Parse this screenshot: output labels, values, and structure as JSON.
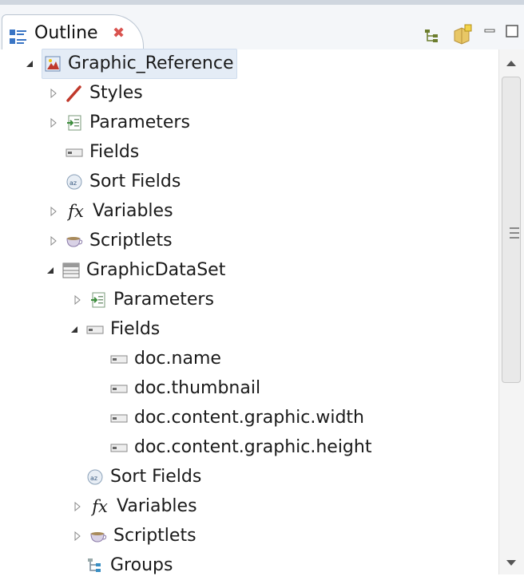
{
  "view": {
    "tab_title": "Outline",
    "close_glyph": "✖"
  },
  "tree": {
    "rows": [
      {
        "label": "Graphic_Reference"
      },
      {
        "label": "Styles"
      },
      {
        "label": "Parameters"
      },
      {
        "label": "Fields"
      },
      {
        "label": "Sort Fields"
      },
      {
        "label": "Variables"
      },
      {
        "label": "Scriptlets"
      },
      {
        "label": "GraphicDataSet"
      },
      {
        "label": "Parameters"
      },
      {
        "label": "Fields"
      },
      {
        "label": "doc.name"
      },
      {
        "label": "doc.thumbnail"
      },
      {
        "label": "doc.content.graphic.width"
      },
      {
        "label": "doc.content.graphic.height"
      },
      {
        "label": "Sort Fields"
      },
      {
        "label": "Variables"
      },
      {
        "label": "Scriptlets"
      },
      {
        "label": "Groups"
      }
    ]
  },
  "icons": {
    "fx_glyph": "fx"
  },
  "colors": {
    "selection": "#e4ecf6",
    "close": "#d9534f",
    "styles_pen": "#c0392b"
  }
}
